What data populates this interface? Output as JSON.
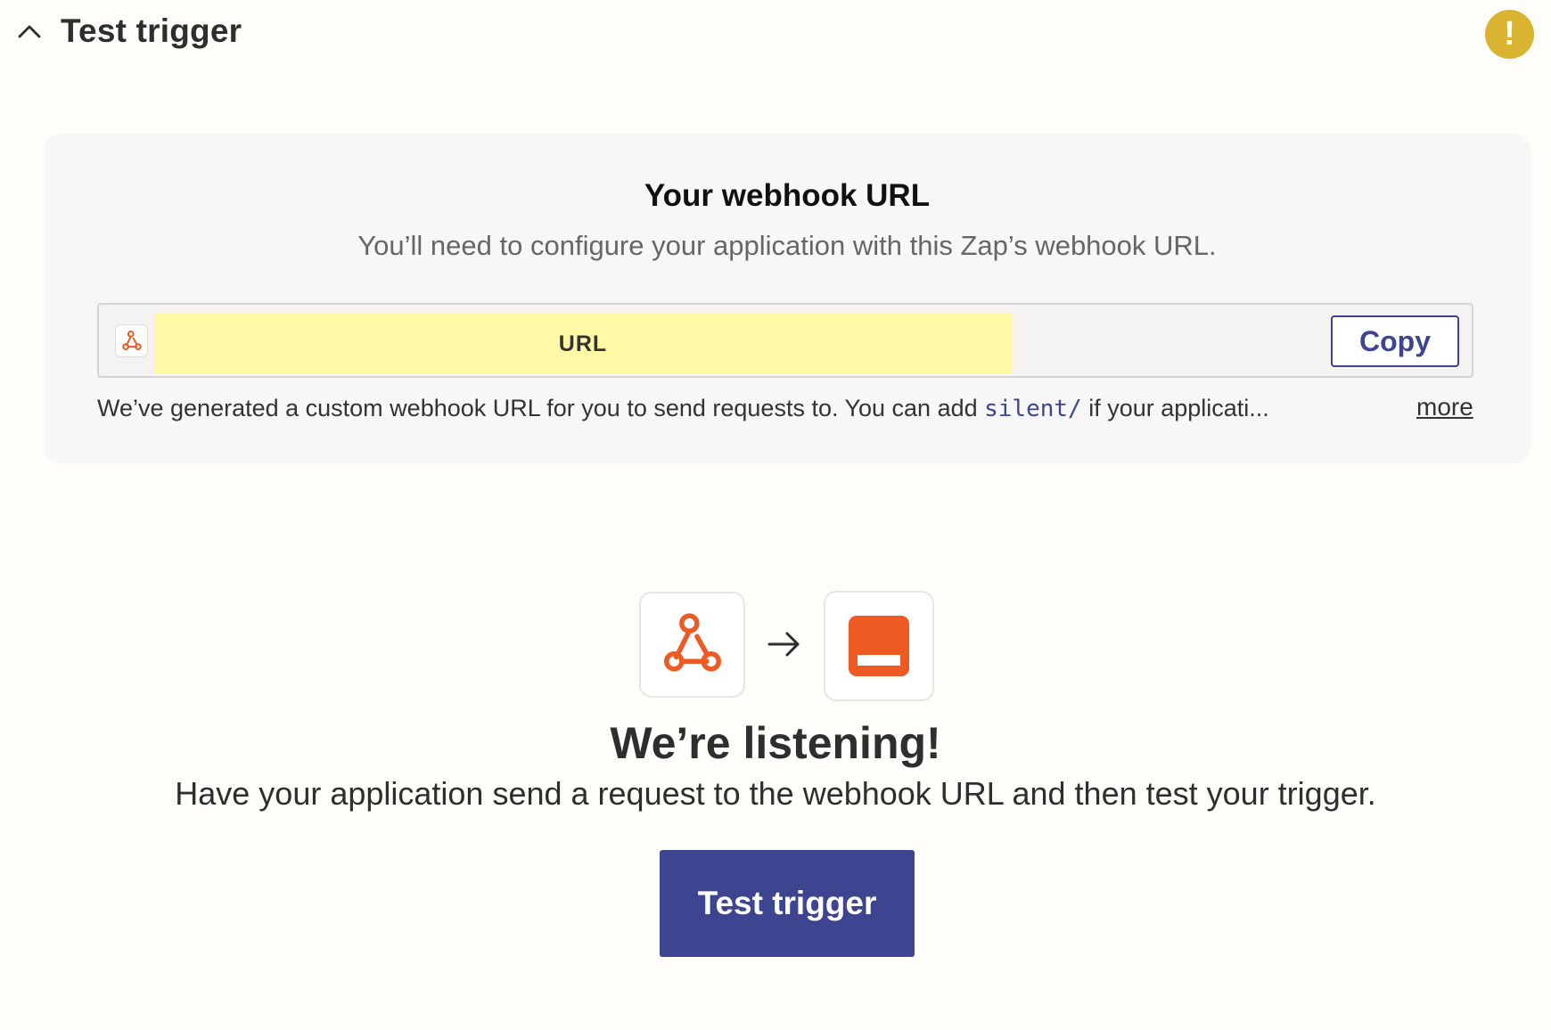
{
  "header": {
    "title": "Test trigger",
    "warning_symbol": "!",
    "collapse_icon": "chevron-up-icon",
    "warning_icon": "warning-badge-icon"
  },
  "webhook_card": {
    "title": "Your webhook URL",
    "subtitle": "You’ll need to configure your application with this Zap’s webhook URL.",
    "url_label": "URL",
    "copy_label": "Copy",
    "helper_prefix": "We’ve generated a custom webhook URL for you to send requests to. You can add ",
    "helper_code": "silent/",
    "helper_suffix": " if your applicati...",
    "more_label": "more",
    "url_icon": "webhook-icon"
  },
  "listening": {
    "title": "We’re listening!",
    "subtitle": "Have your application send a request to the webhook URL and then test your trigger.",
    "button_label": "Test trigger",
    "source_icon": "webhook-icon",
    "arrow_icon": "arrow-right-icon",
    "destination_icon": "app-icon"
  },
  "colors": {
    "accent": "#3d4590",
    "webhook_orange": "#ee5a24",
    "warning": "#d9b431",
    "highlight": "#fff9a5",
    "background": "#fffdf9"
  }
}
